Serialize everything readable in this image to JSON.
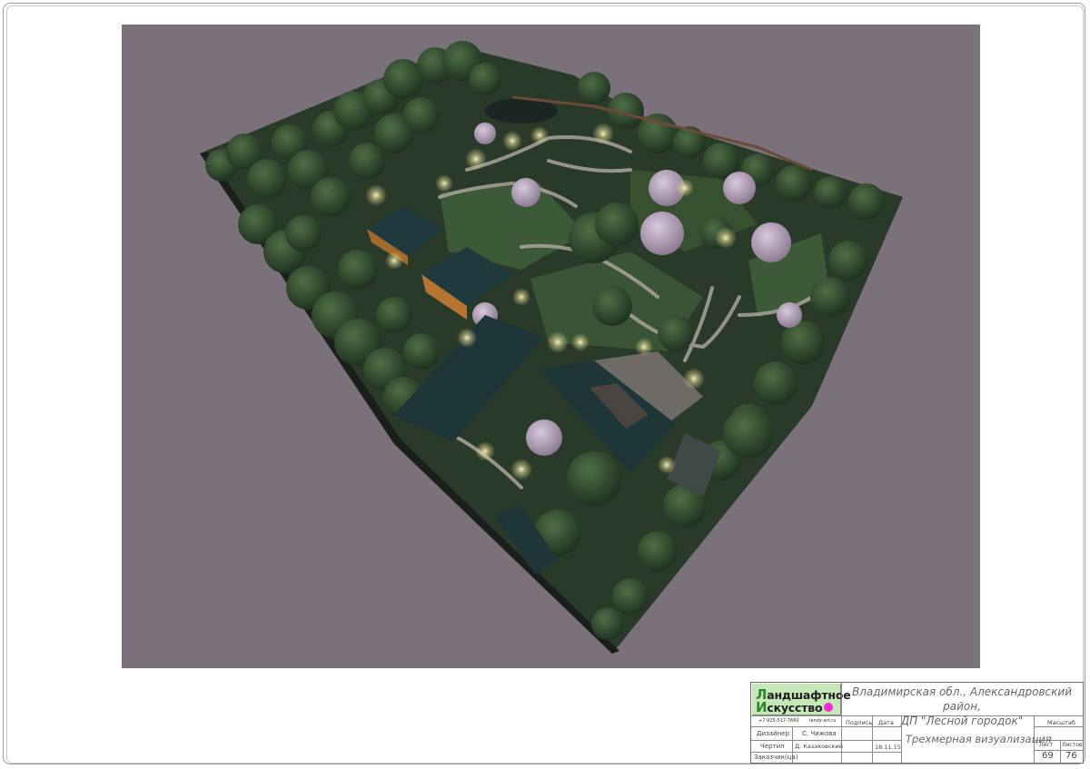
{
  "stamp": {
    "logo_line1_cap": "Л",
    "logo_line1_rest": "андшафтное",
    "logo_line2_cap": "И",
    "logo_line2_rest": "скусство",
    "address_line1": "Владимирская обл., Александровский район,",
    "address_line2": "ДП \"Лесной городок\"",
    "phone": "+7-925-517-7660",
    "website": "landy-art.ru",
    "sign_header": "Подпись",
    "date_header": "Дата",
    "scale_header": "Масштаб",
    "designer_label": "Дизайнер",
    "designer_name": "С. Чижова",
    "drafter_label": "Чертил",
    "drafter_name": "Д. Казаковский",
    "date_value": "18.11.15",
    "client_label": "Заказчик(ца)",
    "drawing_title": "Трехмерная визуализация",
    "sheet_label": "Лист",
    "sheets_label": "Листов",
    "sheet_number": "69",
    "sheets_total": "76"
  },
  "colors": {
    "background": "#7a717a",
    "logo_bg": "#c6e8b8",
    "logo_dot": "#ff2bd2"
  }
}
